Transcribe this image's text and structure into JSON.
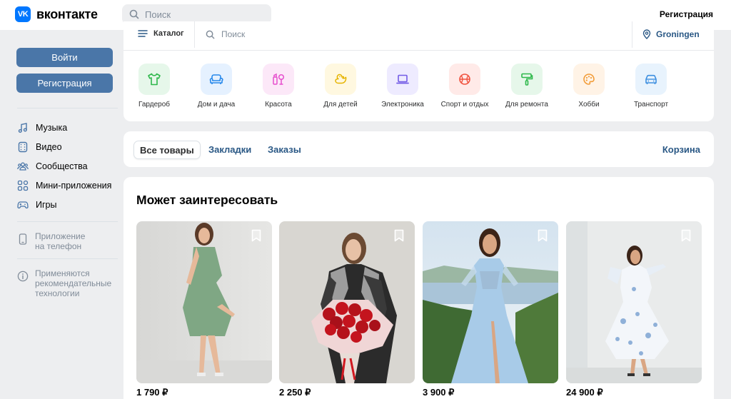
{
  "header": {
    "logo_badge": "VK",
    "logo_text": "вконтакте",
    "search_placeholder": "Поиск",
    "register_link": "Регистрация"
  },
  "sidebar": {
    "login_button": "Войти",
    "register_button": "Регистрация",
    "nav": [
      {
        "label": "Музыка",
        "icon": "music-icon"
      },
      {
        "label": "Видео",
        "icon": "video-icon"
      },
      {
        "label": "Сообщества",
        "icon": "communities-icon"
      },
      {
        "label": "Мини-приложения",
        "icon": "mini-apps-icon"
      },
      {
        "label": "Игры",
        "icon": "games-icon"
      }
    ],
    "app_promo": {
      "line1": "Приложение",
      "line2": "на телефон",
      "icon": "phone-icon"
    },
    "recommendations": {
      "line1": "Применяются",
      "line2": "рекомендательные",
      "line3": "технологии",
      "icon": "info-icon"
    }
  },
  "catalog": {
    "menu_label": "Каталог",
    "search_placeholder": "Поиск",
    "location": "Groningen",
    "categories": [
      {
        "label": "Гардероб",
        "icon": "tshirt-icon",
        "bg": "#e6f7ea",
        "fg": "#2eb84b"
      },
      {
        "label": "Дом и дача",
        "icon": "sofa-icon",
        "bg": "#e5f1ff",
        "fg": "#2688eb"
      },
      {
        "label": "Красота",
        "icon": "beauty-icon",
        "bg": "#fce8f8",
        "fg": "#e64fce"
      },
      {
        "label": "Для детей",
        "icon": "duck-icon",
        "bg": "#fff8e0",
        "fg": "#f5c400"
      },
      {
        "label": "Электроника",
        "icon": "laptop-icon",
        "bg": "#eeebff",
        "fg": "#735ce6"
      },
      {
        "label": "Спорт и отдых",
        "icon": "ball-icon",
        "bg": "#ffeae8",
        "fg": "#f0533f"
      },
      {
        "label": "Для ремонта",
        "icon": "roller-icon",
        "bg": "#e6f7ea",
        "fg": "#2eb84b"
      },
      {
        "label": "Хобби",
        "icon": "palette-icon",
        "bg": "#fff3e6",
        "fg": "#f29c38"
      },
      {
        "label": "Транспорт",
        "icon": "car-icon",
        "bg": "#e8f3fd",
        "fg": "#3d8fe0"
      }
    ]
  },
  "tabs": {
    "items": [
      {
        "label": "Все товары",
        "active": true
      },
      {
        "label": "Закладки",
        "active": false
      },
      {
        "label": "Заказы",
        "active": false
      }
    ],
    "cart": "Корзина"
  },
  "products": {
    "title": "Может заинтересовать",
    "items": [
      {
        "price": "1 790 ₽",
        "bookmark_icon": "bookmark-icon"
      },
      {
        "price": "2 250 ₽",
        "bookmark_icon": "bookmark-icon"
      },
      {
        "price": "3 900 ₽",
        "bookmark_icon": "bookmark-icon"
      },
      {
        "price": "24 900 ₽",
        "bookmark_icon": "bookmark-icon"
      }
    ]
  },
  "colors": {
    "accent": "#4a76a8",
    "link": "#2a5885",
    "vk_blue": "#0077ff",
    "background": "#edeef0"
  }
}
